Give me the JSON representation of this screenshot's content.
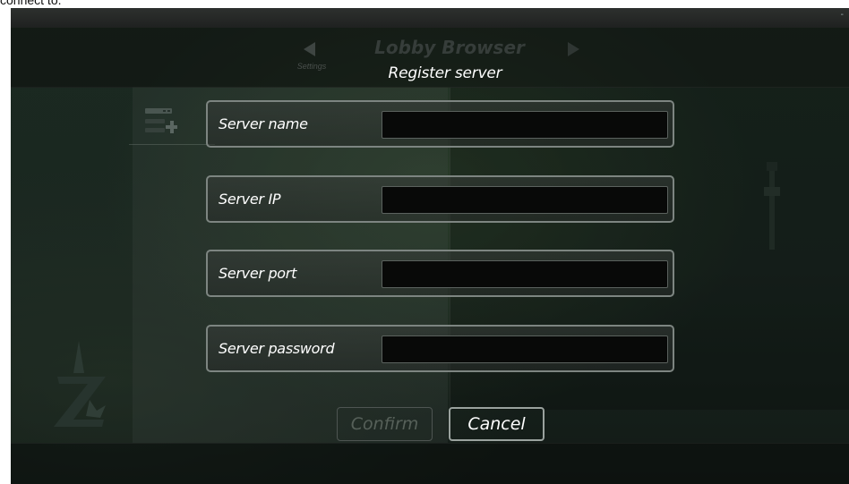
{
  "page_caption": "connect to.",
  "header": {
    "prev_label": "Settings",
    "title": "Lobby Browser",
    "dialog_title": "Register server"
  },
  "form": {
    "fields": [
      {
        "label": "Server name",
        "value": "",
        "placeholder": ""
      },
      {
        "label": "Server IP",
        "value": "",
        "placeholder": ""
      },
      {
        "label": "Server port",
        "value": "",
        "placeholder": ""
      },
      {
        "label": "Server password",
        "value": "",
        "placeholder": ""
      }
    ],
    "confirm_label": "Confirm",
    "cancel_label": "Cancel",
    "confirm_enabled": false
  },
  "colors": {
    "field_border": "#7d8581",
    "input_bg": "#080908",
    "disabled_text": "#566059",
    "text": "#ffffff"
  }
}
